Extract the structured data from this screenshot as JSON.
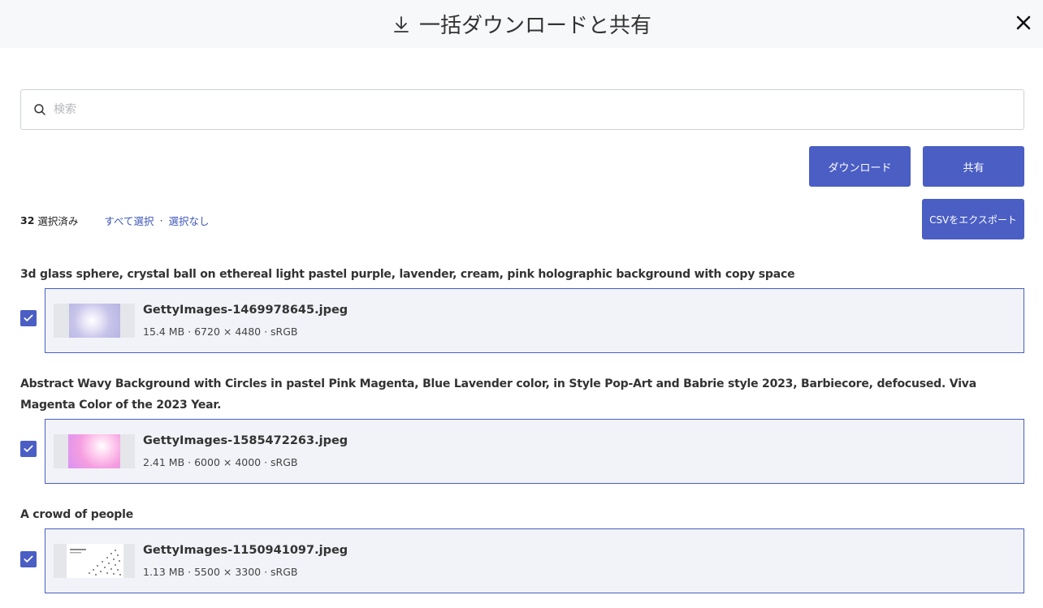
{
  "header": {
    "title": "一括ダウンロードと共有",
    "icon": "download-icon"
  },
  "search": {
    "placeholder": "検索",
    "value": ""
  },
  "actions": {
    "download_label": "ダウンロード",
    "share_label": "共有",
    "csv_label": "CSVをエクスポート"
  },
  "selection": {
    "count": "32",
    "count_suffix": "選択済み",
    "select_all": "すべて選択",
    "select_none": "選択なし",
    "separator": "·"
  },
  "items": [
    {
      "title": "3d glass sphere, crystal ball on ethereal light pastel purple, lavender, cream, pink holographic background with copy space",
      "filename": "GettyImages-1469978645.jpeg",
      "meta": "15.4 MB · 6720 × 4480 · sRGB",
      "checked": true
    },
    {
      "title": "Abstract Wavy Background with Circles in pastel Pink Magenta, Blue Lavender color, in Style Pop-Art and Babrie style 2023, Barbiecore, defocused. Viva Magenta Color of the 2023 Year.",
      "filename": "GettyImages-1585472263.jpeg",
      "meta": "2.41 MB · 6000 × 4000 · sRGB",
      "checked": true
    },
    {
      "title": "A crowd of people",
      "filename": "GettyImages-1150941097.jpeg",
      "meta": "1.13 MB · 5500 × 3300 · sRGB",
      "checked": true
    }
  ],
  "colors": {
    "accent": "#4a5ec4",
    "card_bg": "#f1f3f8",
    "header_bg": "#f7f8fa"
  }
}
